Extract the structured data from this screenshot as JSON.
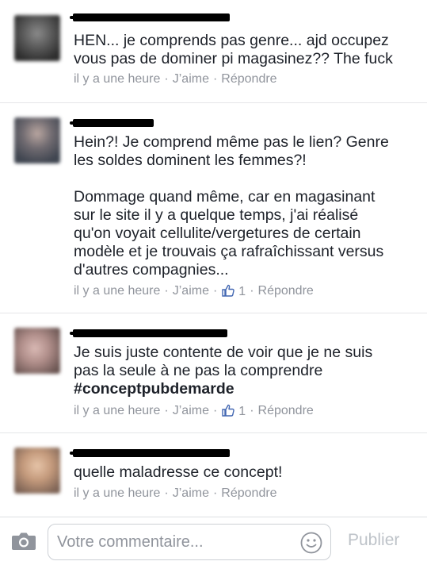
{
  "comments": [
    {
      "lines": [
        "HEN... je comprends pas genre... ajd occupez",
        "vous pas de dominer pi magasinez?? The fuck"
      ],
      "time": "il y a une heure",
      "like": "J’aime",
      "reply": "Répondre",
      "likes": ""
    },
    {
      "lines": [
        "Hein?! Je comprend même pas le lien? Genre",
        "les soldes dominent les femmes?!",
        "",
        "Dommage quand même, car en magasinant",
        "sur le site il y a quelque temps, j'ai réalisé",
        "qu'on voyait cellulite/vergetures de certain",
        "modèle et je trouvais ça rafraîchissant versus",
        "d'autres compagnies..."
      ],
      "time": "il y a une heure",
      "like": "J’aime",
      "reply": "Répondre",
      "likes": "1"
    },
    {
      "lines": [
        "Je suis juste contente de voir que je ne suis",
        "pas la seule à ne pas la comprendre"
      ],
      "hashtag": "#conceptpubdemarde",
      "time": "il y a une heure",
      "like": "J’aime",
      "reply": "Répondre",
      "likes": "1"
    },
    {
      "lines": [
        "quelle maladresse ce concept!"
      ],
      "time": "il y a une heure",
      "like": "J’aime",
      "reply": "Répondre",
      "likes": ""
    }
  ],
  "composer": {
    "placeholder": "Votre commentaire...",
    "publish_label": "Publier"
  },
  "colors": {
    "text": "#1d2129",
    "meta": "#90949c",
    "like_icon": "#4267b2",
    "publish_disabled": "#bec3c9"
  }
}
